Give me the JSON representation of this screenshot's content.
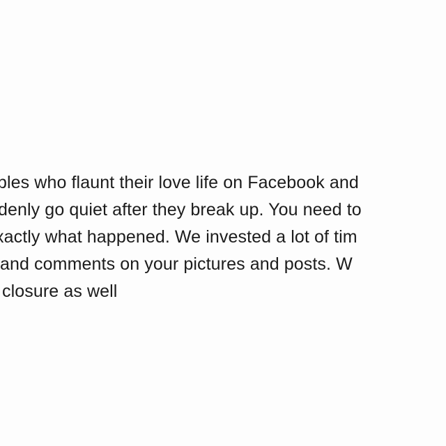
{
  "post": {
    "lines": [
      "bles who flaunt their love life on Facebook and",
      "denly go quiet after they break up. You need to",
      "xactly what happened. We invested a lot of tim",
      " and comments on your pictures and posts. W",
      " closure as well"
    ]
  }
}
